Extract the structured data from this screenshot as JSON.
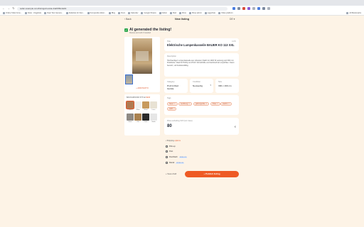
{
  "browser": {
    "url": "seller.example.com/listings/new/ai-draft/8f3c2a91",
    "tab_title": "New listing",
    "bookmarks": [
      {
        "label": "Online Tabel Gros..."
      },
      {
        "label": "Noter - Dagsliste"
      },
      {
        "label": "Daar Test Genera..."
      },
      {
        "label": "Aktieliste for Dan..."
      },
      {
        "label": "Kompendie Aktier..."
      },
      {
        "label": "Blog"
      },
      {
        "label": "Docs"
      },
      {
        "label": "Kalender"
      },
      {
        "label": "Google Sheets"
      },
      {
        "label": "Notion"
      },
      {
        "label": "Mail"
      },
      {
        "label": "Drive"
      },
      {
        "label": "Shop admin"
      },
      {
        "label": "Lagerliste"
      },
      {
        "label": "Video platform"
      }
    ],
    "bookmarks_right": "All Bookmarks"
  },
  "header": {
    "back_label": "Back",
    "title": "New listing",
    "language": "DE"
  },
  "ai_banner": {
    "title": "AI generated the listing!",
    "subtitle": "Review and edit if needed"
  },
  "photos": {
    "add_photo_label": "+ ADD PHOTO"
  },
  "background": {
    "label": "BACKGROUND STYLE",
    "accent": "NEW",
    "swatches": [
      {
        "label": "Original",
        "color": "#b07a52"
      },
      {
        "label": "White",
        "color": "#f1f1f1"
      },
      {
        "label": "Wood",
        "color": "#c79a5e"
      },
      {
        "label": "Linen",
        "color": "#e8e2d4"
      },
      {
        "label": "Stone",
        "color": "#8f8a84"
      },
      {
        "label": "Oak",
        "color": "#a9814f"
      },
      {
        "label": "Dark",
        "color": "#2b2b2b"
      },
      {
        "label": "Studio",
        "color": "#e6e6e6"
      }
    ]
  },
  "title_field": {
    "label": "Title",
    "value": "Elektrische Lumpenkasseile BAUER KO 113 XXL",
    "count": "42/80"
  },
  "description_field": {
    "label": "Description",
    "value": "Hochwertiger Lumpenkasseile aus robustem Stahl mit 1400 W Leistung und 300 mm Fräsbreite. Ideal für Hobby und Profi. Schutzbrille und Gehörschutz empfohlen. Kaum benutzt, voll funktionsfähig."
  },
  "category_field": {
    "label": "Category",
    "value": "Profi & Rad",
    "value2": "Geräte"
  },
  "condition_field": {
    "label": "Condition",
    "value": "Neuwertig"
  },
  "size_field": {
    "label": "Size",
    "value": "300 x 160 cm"
  },
  "tags": {
    "label": "Tags",
    "items": [
      {
        "label": "bauer"
      },
      {
        "label": "werkzeug"
      },
      {
        "label": "gartengeräte"
      },
      {
        "label": "fräse"
      },
      {
        "label": "elektro"
      },
      {
        "label": "stahl"
      }
    ]
  },
  "price": {
    "label": "Price excluding VAT (incl. fees)",
    "value": "80",
    "currency_icon": "€"
  },
  "shipping": {
    "heading": "Shipping",
    "accent": "options",
    "options": [
      {
        "label": "Pick-up",
        "badge": ""
      },
      {
        "label": "Post",
        "badge": ""
      },
      {
        "label": "DoorDash",
        "badge": "FROM 4.95"
      },
      {
        "label": "Dansk",
        "badge": "FROM 3.50"
      }
    ]
  },
  "actions": {
    "save_draft": "+ Save draft",
    "publish": "+ Publish listing"
  },
  "colors": {
    "accent": "#ee5a24",
    "success": "#2fa84f",
    "page_bg": "#fdf3e6"
  }
}
